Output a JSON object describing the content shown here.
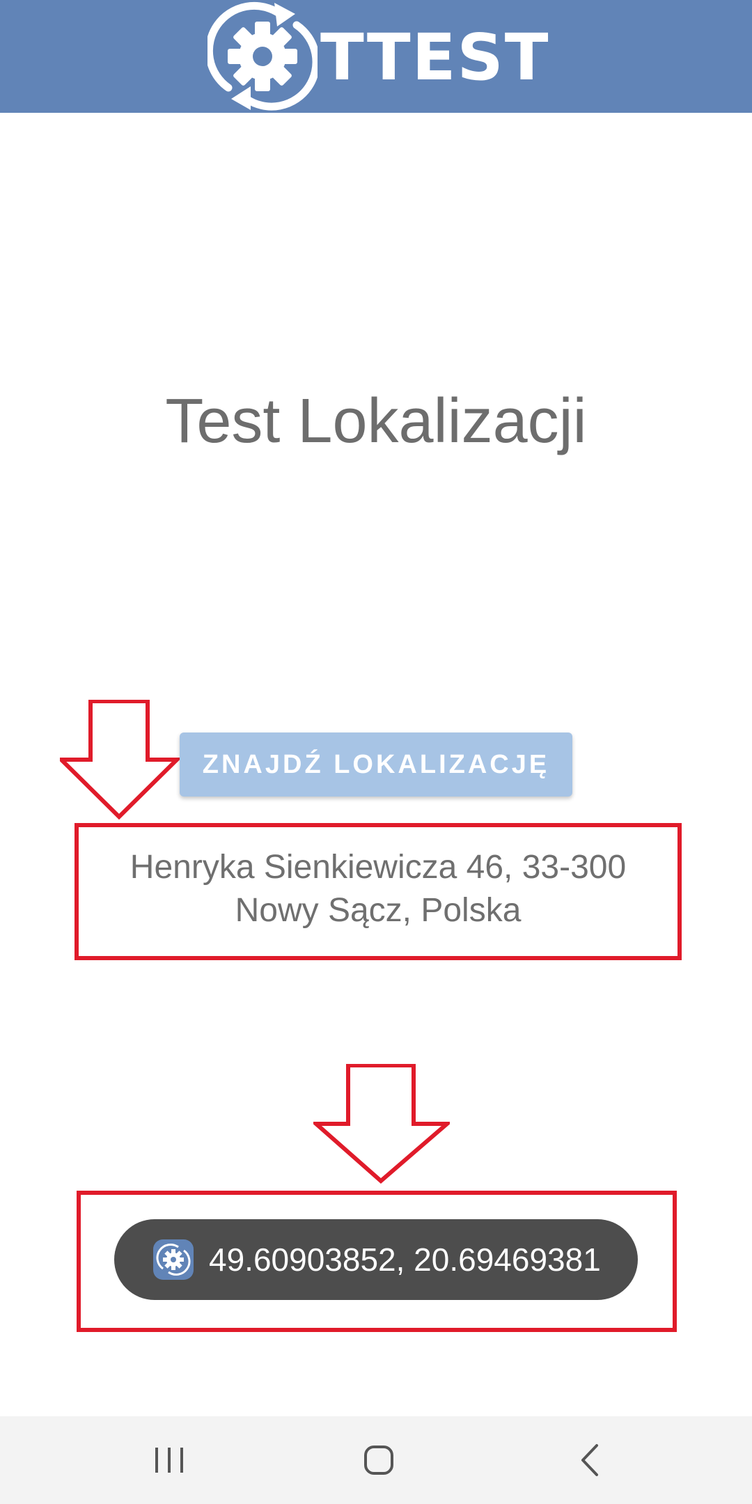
{
  "header": {
    "logo_text": "TTEST",
    "logo_icon": "gear-sync-icon",
    "background_color": "#6184b7"
  },
  "main": {
    "title": "Test Lokalizacji",
    "find_location_button": "ZNAJDŹ LOKALIZACJĘ",
    "address_lines": [
      "Henryka Sienkiewicza 46, 33-300",
      "Nowy Sącz, Polska"
    ]
  },
  "toast": {
    "icon": "app-gear-icon",
    "text": "49.60903852, 20.69469381"
  },
  "annotations": {
    "color": "#e01b2a",
    "arrow_icon": "down-arrow-icon"
  },
  "navbar": {
    "icons": [
      "recent-apps-icon",
      "home-icon",
      "back-icon"
    ]
  }
}
